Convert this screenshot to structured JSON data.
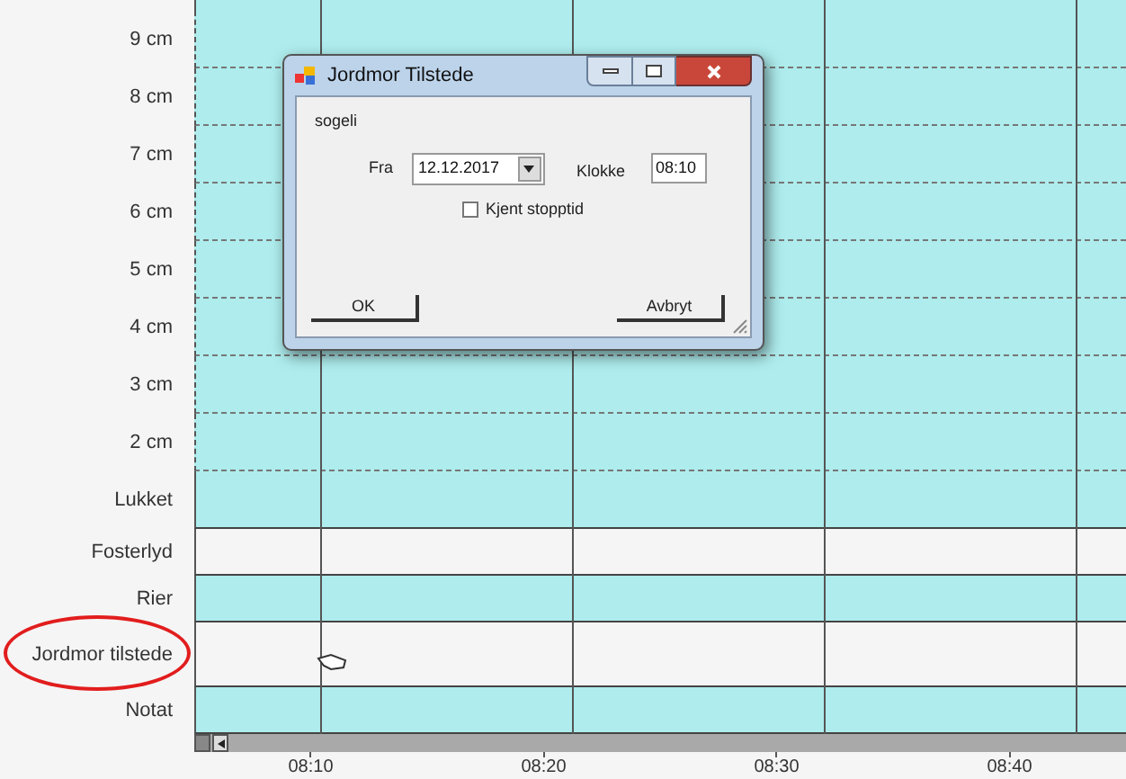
{
  "rows": [
    {
      "label": "9 cm",
      "shaded": true,
      "kind": "scale",
      "circled": false
    },
    {
      "label": "8 cm",
      "shaded": true,
      "kind": "scale",
      "circled": false
    },
    {
      "label": "7 cm",
      "shaded": true,
      "kind": "scale",
      "circled": false
    },
    {
      "label": "6 cm",
      "shaded": true,
      "kind": "scale",
      "circled": false
    },
    {
      "label": "5 cm",
      "shaded": true,
      "kind": "scale",
      "circled": false
    },
    {
      "label": "4 cm",
      "shaded": true,
      "kind": "scale",
      "circled": false
    },
    {
      "label": "3 cm",
      "shaded": true,
      "kind": "scale",
      "circled": false
    },
    {
      "label": "2 cm",
      "shaded": true,
      "kind": "scale",
      "circled": false
    },
    {
      "label": "Lukket",
      "shaded": true,
      "kind": "scale",
      "circled": false
    },
    {
      "label": "Fosterlyd",
      "shaded": false,
      "kind": "event",
      "circled": false
    },
    {
      "label": "Rier",
      "shaded": true,
      "kind": "event",
      "circled": false
    },
    {
      "label": "Jordmor tilstede",
      "shaded": false,
      "kind": "tall",
      "circled": true
    },
    {
      "label": "Notat",
      "shaded": true,
      "kind": "event",
      "circled": false
    }
  ],
  "time_axis": [
    "08:10",
    "08:20",
    "08:30",
    "08:40"
  ],
  "dialog": {
    "title": "Jordmor Tilstede",
    "user": "sogeli",
    "from_label": "Fra",
    "date": "12.12.2017",
    "time_label": "Klokke",
    "time": "08:10",
    "checkbox": {
      "label": "Kjent stopptid",
      "checked": false
    },
    "buttons": [
      "OK",
      "Avbryt"
    ]
  }
}
